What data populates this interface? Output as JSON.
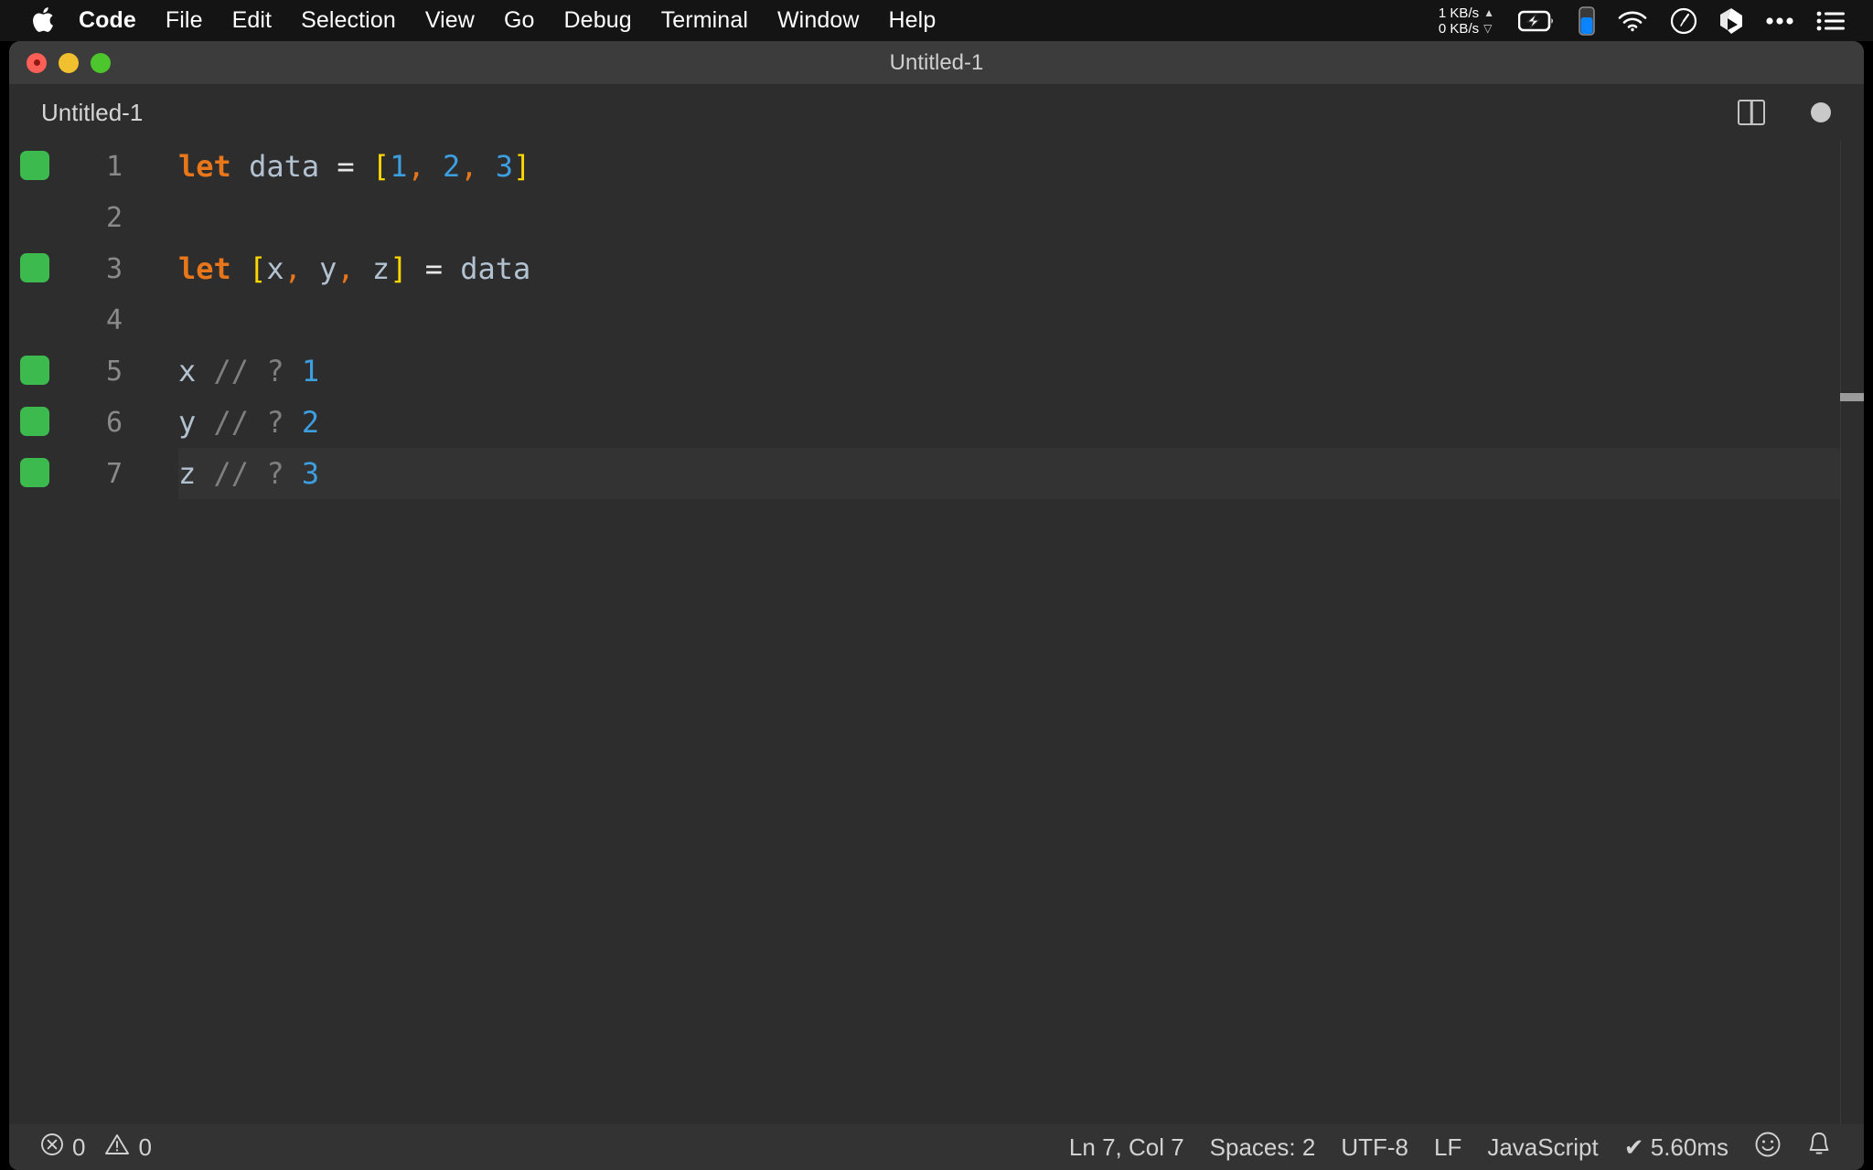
{
  "menubar": {
    "apple_icon": "apple-logo-icon",
    "items": [
      {
        "label": "Code",
        "bold": true
      },
      {
        "label": "File",
        "bold": false
      },
      {
        "label": "Edit",
        "bold": false
      },
      {
        "label": "Selection",
        "bold": false
      },
      {
        "label": "View",
        "bold": false
      },
      {
        "label": "Go",
        "bold": false
      },
      {
        "label": "Debug",
        "bold": false
      },
      {
        "label": "Terminal",
        "bold": false
      },
      {
        "label": "Window",
        "bold": false
      },
      {
        "label": "Help",
        "bold": false
      }
    ],
    "network": {
      "upload": "1 KB/s",
      "download": "0 KB/s",
      "up_arrow": "▲",
      "down_arrow": "▽"
    },
    "status_icons": [
      "battery-charging-icon",
      "battery-level-icon",
      "wifi-icon",
      "clock-icon",
      "dropbox-icon",
      "ellipsis-icon",
      "menu-list-icon"
    ]
  },
  "window": {
    "title": "Untitled-1",
    "traffic_lights": [
      "close-button",
      "minimize-button",
      "maximize-button"
    ]
  },
  "tabbar": {
    "tabs": [
      {
        "label": "Untitled-1",
        "active": true,
        "dirty": true
      }
    ],
    "actions": [
      "split-editor-icon",
      "unsaved-dot-icon"
    ]
  },
  "editor": {
    "language": "JavaScript",
    "lines": [
      {
        "number": "1",
        "marker": true,
        "active": false,
        "tokens": [
          {
            "t": "let",
            "c": "tok-keyword"
          },
          {
            "t": " ",
            "c": "tok-plain"
          },
          {
            "t": "data",
            "c": "tok-variable"
          },
          {
            "t": " ",
            "c": "tok-plain"
          },
          {
            "t": "=",
            "c": "tok-operator"
          },
          {
            "t": " ",
            "c": "tok-plain"
          },
          {
            "t": "[",
            "c": "tok-bracket"
          },
          {
            "t": "1",
            "c": "tok-number"
          },
          {
            "t": ",",
            "c": "tok-punct"
          },
          {
            "t": " ",
            "c": "tok-plain"
          },
          {
            "t": "2",
            "c": "tok-number"
          },
          {
            "t": ",",
            "c": "tok-punct"
          },
          {
            "t": " ",
            "c": "tok-plain"
          },
          {
            "t": "3",
            "c": "tok-number"
          },
          {
            "t": "]",
            "c": "tok-bracket"
          }
        ]
      },
      {
        "number": "2",
        "marker": false,
        "active": false,
        "tokens": []
      },
      {
        "number": "3",
        "marker": true,
        "active": false,
        "tokens": [
          {
            "t": "let",
            "c": "tok-keyword"
          },
          {
            "t": " ",
            "c": "tok-plain"
          },
          {
            "t": "[",
            "c": "tok-bracket"
          },
          {
            "t": "x",
            "c": "tok-variable"
          },
          {
            "t": ",",
            "c": "tok-punct"
          },
          {
            "t": " ",
            "c": "tok-plain"
          },
          {
            "t": "y",
            "c": "tok-variable"
          },
          {
            "t": ",",
            "c": "tok-punct"
          },
          {
            "t": " ",
            "c": "tok-plain"
          },
          {
            "t": "z",
            "c": "tok-variable"
          },
          {
            "t": "]",
            "c": "tok-bracket"
          },
          {
            "t": " ",
            "c": "tok-plain"
          },
          {
            "t": "=",
            "c": "tok-operator"
          },
          {
            "t": " ",
            "c": "tok-plain"
          },
          {
            "t": "data",
            "c": "tok-variable"
          }
        ]
      },
      {
        "number": "4",
        "marker": false,
        "active": false,
        "tokens": []
      },
      {
        "number": "5",
        "marker": true,
        "active": false,
        "tokens": [
          {
            "t": "x",
            "c": "tok-variable"
          },
          {
            "t": " ",
            "c": "tok-plain"
          },
          {
            "t": "// ?",
            "c": "tok-comment"
          },
          {
            "t": " ",
            "c": "tok-plain"
          },
          {
            "t": "1",
            "c": "tok-number"
          }
        ]
      },
      {
        "number": "6",
        "marker": true,
        "active": false,
        "tokens": [
          {
            "t": "y",
            "c": "tok-variable"
          },
          {
            "t": " ",
            "c": "tok-plain"
          },
          {
            "t": "// ?",
            "c": "tok-comment"
          },
          {
            "t": " ",
            "c": "tok-plain"
          },
          {
            "t": "2",
            "c": "tok-number"
          }
        ]
      },
      {
        "number": "7",
        "marker": true,
        "active": true,
        "tokens": [
          {
            "t": "z",
            "c": "tok-variable"
          },
          {
            "t": " ",
            "c": "tok-plain"
          },
          {
            "t": "// ?",
            "c": "tok-comment"
          },
          {
            "t": " ",
            "c": "tok-plain"
          },
          {
            "t": "3",
            "c": "tok-number"
          }
        ]
      }
    ]
  },
  "statusbar": {
    "errors": "0",
    "warnings": "0",
    "error_icon": "error-circle-icon",
    "warning_icon": "warning-triangle-icon",
    "cursor_position": "Ln 7, Col 7",
    "indentation": "Spaces: 2",
    "encoding": "UTF-8",
    "line_ending": "LF",
    "language_mode": "JavaScript",
    "quokka_status": "✔ 5.60ms",
    "feedback_icon": "smiley-icon",
    "notifications_icon": "bell-icon"
  },
  "colors": {
    "menubar_bg": "#141414",
    "titlebar_bg": "#3c3c3c",
    "editor_bg": "#2d2d2d",
    "statusbar_bg": "#333333",
    "active_line_bg": "#333333",
    "quokka_green": "#3dba4e",
    "keyword_orange": "#e8761a",
    "bracket_yellow": "#ffd700",
    "number_blue": "#3d9ee0",
    "variable_gray": "#b3c2d1",
    "comment_gray": "#7f7f7f"
  }
}
